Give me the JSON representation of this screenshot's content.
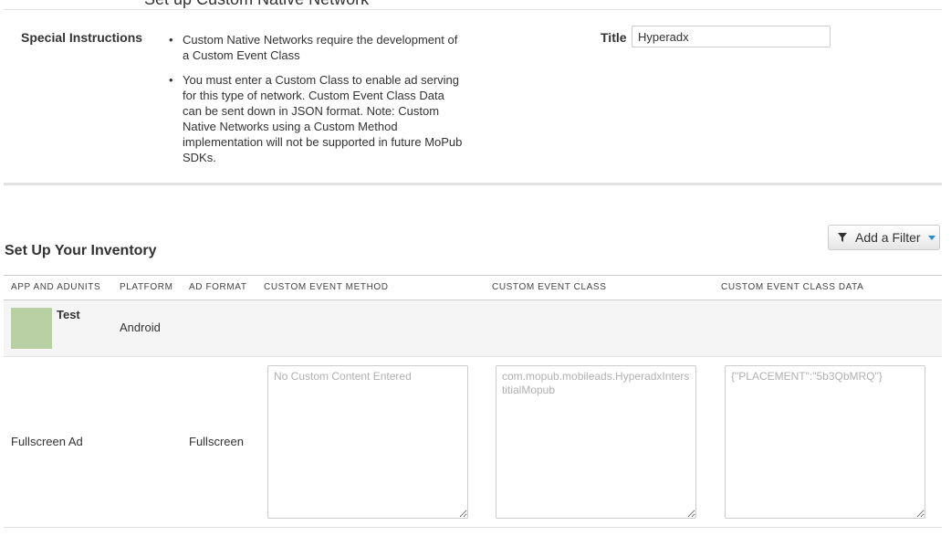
{
  "page": {
    "heading": "Set up Custom Native Network"
  },
  "special_instructions": {
    "label": "Special Instructions",
    "items": [
      "Custom Native Networks require the development of a Custom Event Class",
      "You must enter a Custom Class to enable ad serving for this type of network. Custom Event Class Data can be sent down in JSON format. Note: Custom Native Networks using a Custom Method implementation will not be supported in future MoPub SDKs."
    ]
  },
  "title_field": {
    "label": "Title",
    "value": "Hyperadx"
  },
  "inventory": {
    "title": "Set Up Your Inventory",
    "filter_button": {
      "label": "Add a Filter",
      "icon": "filter-funnel-icon",
      "caret_color": "#2a8bd2"
    },
    "columns": [
      "APP AND ADUNITS",
      "PLATFORM",
      "AD FORMAT",
      "CUSTOM EVENT METHOD",
      "CUSTOM EVENT CLASS",
      "CUSTOM EVENT CLASS DATA"
    ],
    "app": {
      "name": "Test",
      "platform": "Android",
      "thumb_color": "#b9cfa4"
    },
    "adunit": {
      "name": "Fullscreen Ad",
      "format": "Fullscreen",
      "method_placeholder": "No Custom Content Entered",
      "class_placeholder": "com.mopub.mobileads.HyperadxInterstitialMopub",
      "data_placeholder": "{\"PLACEMENT\":\"5b3QbMRQ\"}"
    }
  }
}
